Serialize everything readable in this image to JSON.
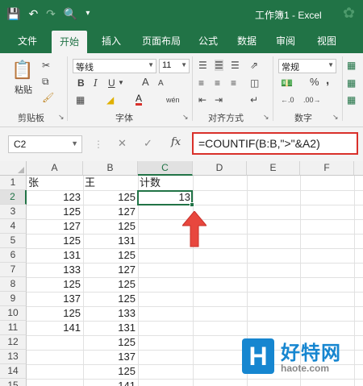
{
  "window": {
    "title": "工作簿1 - Excel",
    "qat": {
      "save": "save-icon",
      "undo": "undo-icon",
      "redo": "redo-icon",
      "preview": "print-preview-icon"
    }
  },
  "tabs": [
    "文件",
    "开始",
    "插入",
    "页面布局",
    "公式",
    "数据",
    "审阅",
    "视图"
  ],
  "ribbon": {
    "clipboard": {
      "paste": "粘贴",
      "label": "剪贴板"
    },
    "font": {
      "name": "等线",
      "size": "11",
      "bold": "B",
      "italic": "I",
      "underline": "U",
      "grow": "A",
      "shrink": "A",
      "color": "A",
      "phonetic": "wén",
      "label": "字体"
    },
    "alignment": {
      "label": "对齐方式"
    },
    "number": {
      "format": "常规",
      "percent": "%",
      "comma": ",",
      "label": "数字"
    }
  },
  "formula_bar": {
    "name_box": "C2",
    "cancel": "✕",
    "enter": "✓",
    "fx": "fx",
    "formula": "=COUNTIF(B:B,\">\"&A2)"
  },
  "sheet": {
    "columns": [
      "A",
      "B",
      "C",
      "D",
      "E",
      "F"
    ],
    "rows": [
      "1",
      "2",
      "3",
      "4",
      "5",
      "6",
      "7",
      "8",
      "9",
      "10",
      "11",
      "12",
      "13",
      "14",
      "15"
    ],
    "selected_cell": "C2",
    "headers": {
      "a1": "张",
      "b1": "王",
      "c1": "计数"
    },
    "col_a": [
      "123",
      "125",
      "127",
      "125",
      "131",
      "133",
      "125",
      "137",
      "125",
      "141"
    ],
    "col_b": [
      "125",
      "127",
      "125",
      "131",
      "125",
      "127",
      "125",
      "125",
      "133",
      "131",
      "125",
      "137",
      "125",
      "141"
    ],
    "c2": "13"
  },
  "colors": {
    "excel_green": "#217346",
    "highlight_red": "#d9302a",
    "watermark_blue": "#1686d0"
  },
  "watermark": {
    "logo": "H",
    "text": "好特网",
    "url": "haote.com"
  }
}
